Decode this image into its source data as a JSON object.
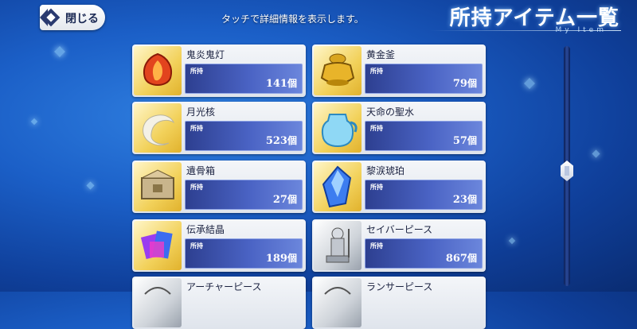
{
  "header": {
    "close_label": "閉じる",
    "hint": "タッチで詳細情報を表示します。",
    "title": "所持アイテム一覧",
    "subtitle": "My Item"
  },
  "count_label": "所持",
  "count_unit": "個",
  "items": [
    {
      "name": "鬼炎鬼灯",
      "count": "141",
      "icon": "flame-lantern-icon",
      "frame": "gold"
    },
    {
      "name": "黄金釜",
      "count": "79",
      "icon": "golden-cauldron-icon",
      "frame": "gold"
    },
    {
      "name": "月光核",
      "count": "523",
      "icon": "crescent-moon-icon",
      "frame": "gold"
    },
    {
      "name": "天命の聖水",
      "count": "57",
      "icon": "holy-water-jug-icon",
      "frame": "gold"
    },
    {
      "name": "遺骨箱",
      "count": "27",
      "icon": "reliquary-box-icon",
      "frame": "gold"
    },
    {
      "name": "黎涙琥珀",
      "count": "23",
      "icon": "blue-crystal-icon",
      "frame": "gold"
    },
    {
      "name": "伝承結晶",
      "count": "189",
      "icon": "lore-crystal-icon",
      "frame": "gold"
    },
    {
      "name": "セイバーピース",
      "count": "867",
      "icon": "saber-piece-icon",
      "frame": "silver"
    },
    {
      "name": "アーチャーピース",
      "count": "",
      "icon": "archer-piece-icon",
      "frame": "silver"
    },
    {
      "name": "ランサーピース",
      "count": "",
      "icon": "lancer-piece-icon",
      "frame": "silver"
    }
  ],
  "colors": {
    "background": "#1b5fc7",
    "count_bar": "#4a63c4",
    "gold_frame": "#f2d15a"
  }
}
